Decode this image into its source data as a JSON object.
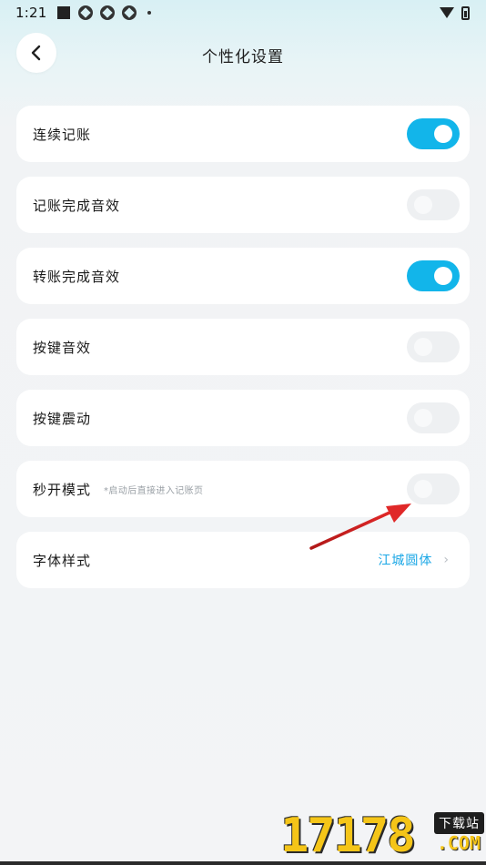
{
  "status_bar": {
    "time": "1:21",
    "icons": [
      "notification-square-icon",
      "app-notification-icon",
      "app-notification-icon",
      "app-notification-icon",
      "more-dot-icon",
      "wifi-icon",
      "battery-icon"
    ]
  },
  "header": {
    "back_icon": "chevron-left-icon",
    "title": "个性化设置"
  },
  "settings": [
    {
      "label": "连续记账",
      "type": "toggle",
      "on": true
    },
    {
      "label": "记账完成音效",
      "type": "toggle",
      "on": false
    },
    {
      "label": "转账完成音效",
      "type": "toggle",
      "on": true
    },
    {
      "label": "按键音效",
      "type": "toggle",
      "on": false
    },
    {
      "label": "按键震动",
      "type": "toggle",
      "on": false
    },
    {
      "label": "秒开模式",
      "hint": "*启动后直接进入记账页",
      "type": "toggle",
      "on": false
    },
    {
      "label": "字体样式",
      "type": "select",
      "value": "江城圆体",
      "icon": "chevron-right-icon"
    }
  ],
  "colors": {
    "accent": "#12b5ea",
    "value_text": "#1aa7e6",
    "toggle_off": "#eef0f2",
    "annotation_arrow": "#d42020"
  },
  "watermark": {
    "number": "17178",
    "badge": "下载站",
    "domain": ".COM"
  }
}
